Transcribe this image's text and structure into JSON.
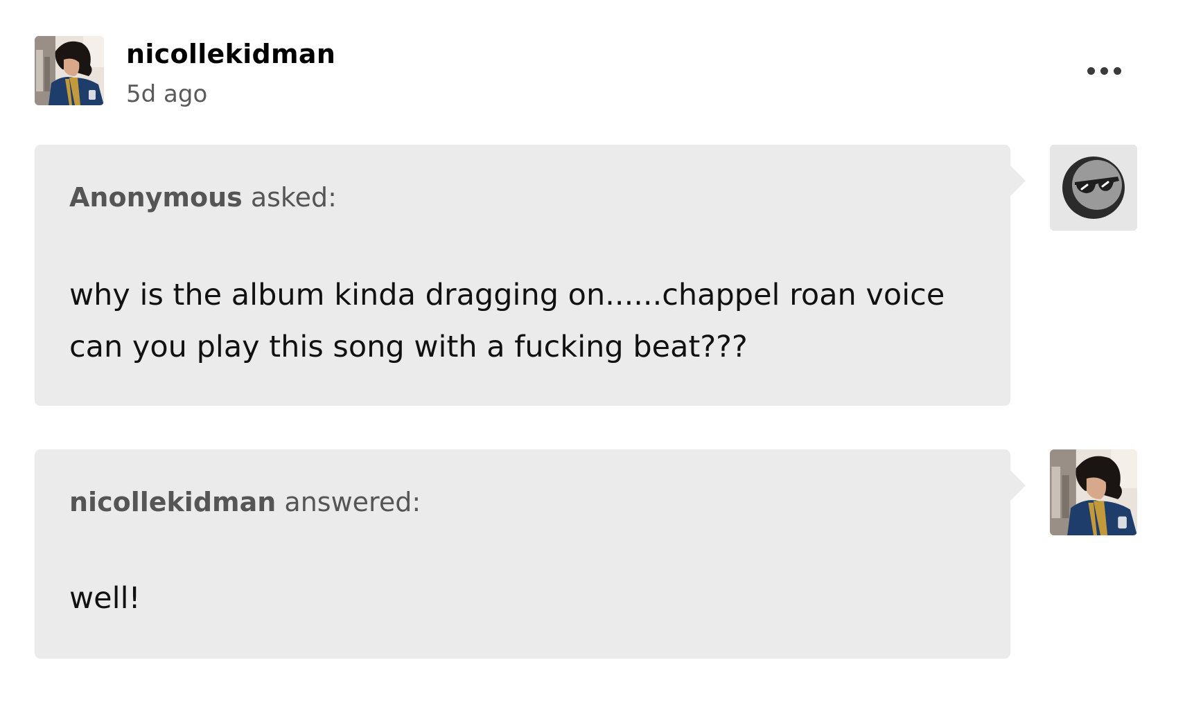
{
  "post": {
    "blog_name": "nicollekidman",
    "time": "5d ago",
    "more_icon": "more-horizontal-icon"
  },
  "ask": {
    "asker": "Anonymous",
    "verb": " asked:",
    "question": "why is the album kinda dragging on......chappel roan voice can you play this song with a fucking beat???",
    "avatar_icon": "anonymous-sunglasses-icon"
  },
  "answer": {
    "answerer": "nicollekidman",
    "verb": " answered:",
    "text": "well!"
  },
  "colors": {
    "bubble_background": "#ebebeb",
    "secondary_text": "#555555",
    "timestamp_text": "#5a5a5a"
  }
}
